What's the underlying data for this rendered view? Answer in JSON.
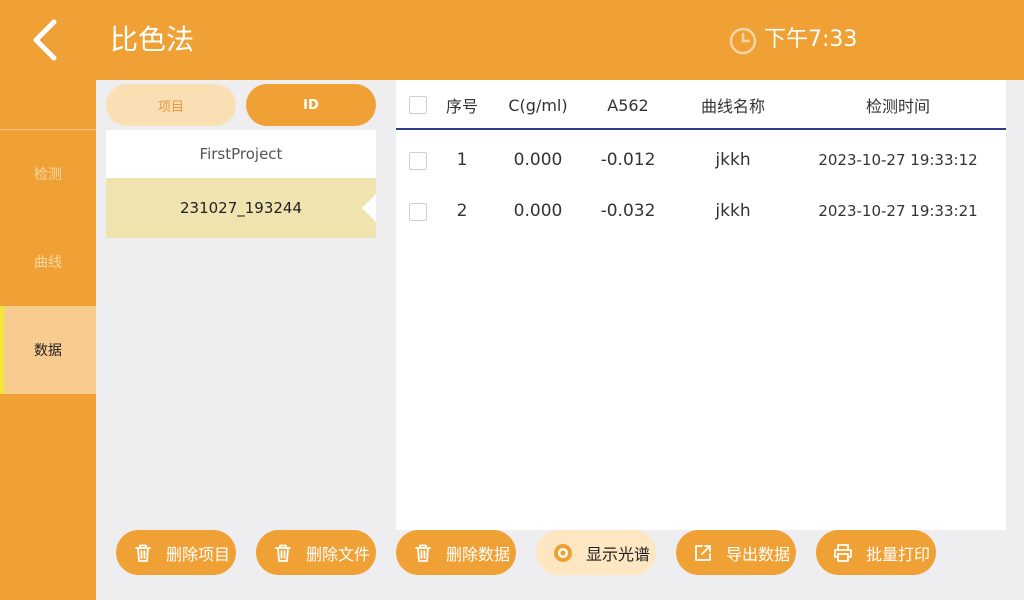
{
  "header": {
    "title": "比色法",
    "time": "下午7:33"
  },
  "sidebar": {
    "items": [
      {
        "label": "检测"
      },
      {
        "label": "曲线"
      },
      {
        "label": "数据"
      }
    ]
  },
  "segments": {
    "project": "项目",
    "id": "ID"
  },
  "list": {
    "items": [
      {
        "label": "FirstProject"
      },
      {
        "label": "231027_193244"
      }
    ]
  },
  "table": {
    "headers": {
      "index": "序号",
      "conc": "C(g/ml)",
      "abs": "A562",
      "curve": "曲线名称",
      "time": "检测时间"
    },
    "rows": [
      {
        "index": "1",
        "conc": "0.000",
        "abs": "-0.012",
        "curve": "jkkh",
        "time": "2023-10-27 19:33:12"
      },
      {
        "index": "2",
        "conc": "0.000",
        "abs": "-0.032",
        "curve": "jkkh",
        "time": "2023-10-27 19:33:21"
      }
    ]
  },
  "buttons": {
    "delete_project": "删除项目",
    "delete_file": "删除文件",
    "delete_data": "删除数据",
    "show_spectrum": "显示光谱",
    "export_data": "导出数据",
    "batch_print": "批量打印"
  },
  "colors": {
    "accent": "#f0a135",
    "selected_item": "#efe3b0",
    "header_rule": "#2f3a8a"
  }
}
